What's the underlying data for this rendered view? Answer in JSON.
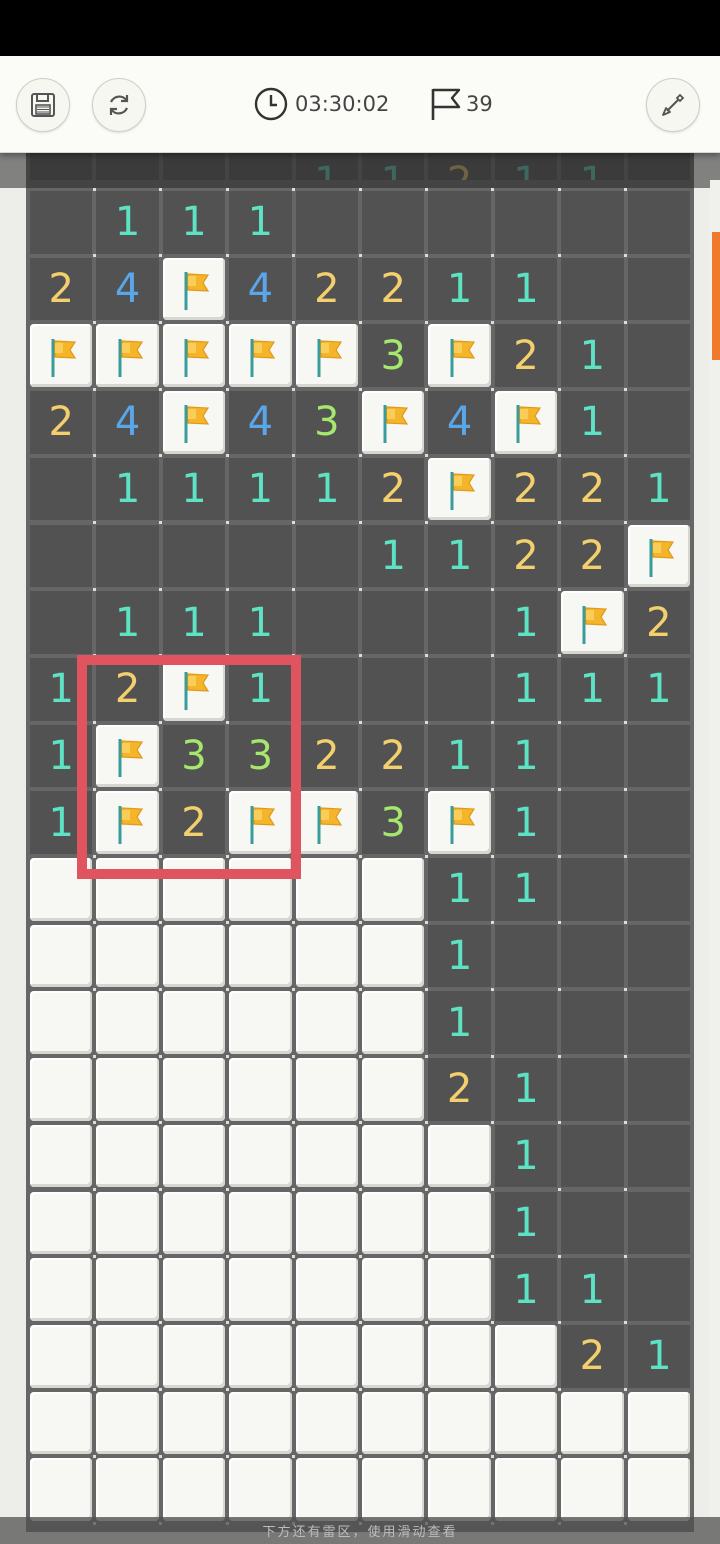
{
  "toolbar": {
    "save_icon": "save-icon",
    "restart_icon": "refresh-icon",
    "timer_icon": "clock-icon",
    "timer": "03:30:02",
    "flag_icon": "flag-icon",
    "flag_count": "39",
    "shovel_icon": "shovel-icon"
  },
  "board": {
    "columns": 10,
    "legend": "o = empty revealed, # = covered, F = flagged, digit = revealed number",
    "partial_top_row": [
      "o",
      "o",
      "o",
      "o",
      "1",
      "1",
      "2",
      "1",
      "1",
      "o"
    ],
    "rows": [
      [
        "o",
        "1",
        "1",
        "1",
        "o",
        "o",
        "o",
        "o",
        "o",
        "o"
      ],
      [
        "2",
        "4",
        "F",
        "4",
        "2",
        "2",
        "1",
        "1",
        "o",
        "o"
      ],
      [
        "F",
        "F",
        "F",
        "F",
        "F",
        "3",
        "F",
        "2",
        "1",
        "o"
      ],
      [
        "2",
        "4",
        "F",
        "4",
        "3",
        "F",
        "4",
        "F",
        "1",
        "o"
      ],
      [
        "o",
        "1",
        "1",
        "1",
        "1",
        "2",
        "F",
        "2",
        "2",
        "1"
      ],
      [
        "o",
        "o",
        "o",
        "o",
        "o",
        "1",
        "1",
        "2",
        "2",
        "F"
      ],
      [
        "o",
        "1",
        "1",
        "1",
        "o",
        "o",
        "o",
        "1",
        "F",
        "2"
      ],
      [
        "1",
        "2",
        "F",
        "1",
        "o",
        "o",
        "o",
        "1",
        "1",
        "1"
      ],
      [
        "1",
        "F",
        "3",
        "3",
        "2",
        "2",
        "1",
        "1",
        "o",
        "o"
      ],
      [
        "1",
        "F",
        "2",
        "F",
        "F",
        "3",
        "F",
        "1",
        "o",
        "o"
      ],
      [
        "#",
        "#",
        "#",
        "#",
        "#",
        "#",
        "1",
        "1",
        "o",
        "o"
      ],
      [
        "#",
        "#",
        "#",
        "#",
        "#",
        "#",
        "1",
        "o",
        "o",
        "o"
      ],
      [
        "#",
        "#",
        "#",
        "#",
        "#",
        "#",
        "1",
        "o",
        "o",
        "o"
      ],
      [
        "#",
        "#",
        "#",
        "#",
        "#",
        "#",
        "2",
        "1",
        "o",
        "o"
      ],
      [
        "#",
        "#",
        "#",
        "#",
        "#",
        "#",
        "#",
        "1",
        "o",
        "o"
      ],
      [
        "#",
        "#",
        "#",
        "#",
        "#",
        "#",
        "#",
        "1",
        "o",
        "o"
      ],
      [
        "#",
        "#",
        "#",
        "#",
        "#",
        "#",
        "#",
        "1",
        "1",
        "o"
      ],
      [
        "#",
        "#",
        "#",
        "#",
        "#",
        "#",
        "#",
        "#",
        "2",
        "1"
      ],
      [
        "#",
        "#",
        "#",
        "#",
        "#",
        "#",
        "#",
        "#",
        "#",
        "#"
      ],
      [
        "#",
        "#",
        "#",
        "#",
        "#",
        "#",
        "#",
        "#",
        "#",
        "#"
      ]
    ]
  },
  "colors": {
    "n1": "#5de3c4",
    "n2": "#f3cf6e",
    "n3": "#a6e86d",
    "n4": "#5aa6ea",
    "highlight": "#e05460",
    "flag": "#f5b52a"
  },
  "footer_hint": "下方还有雷区，使用滑动查看"
}
